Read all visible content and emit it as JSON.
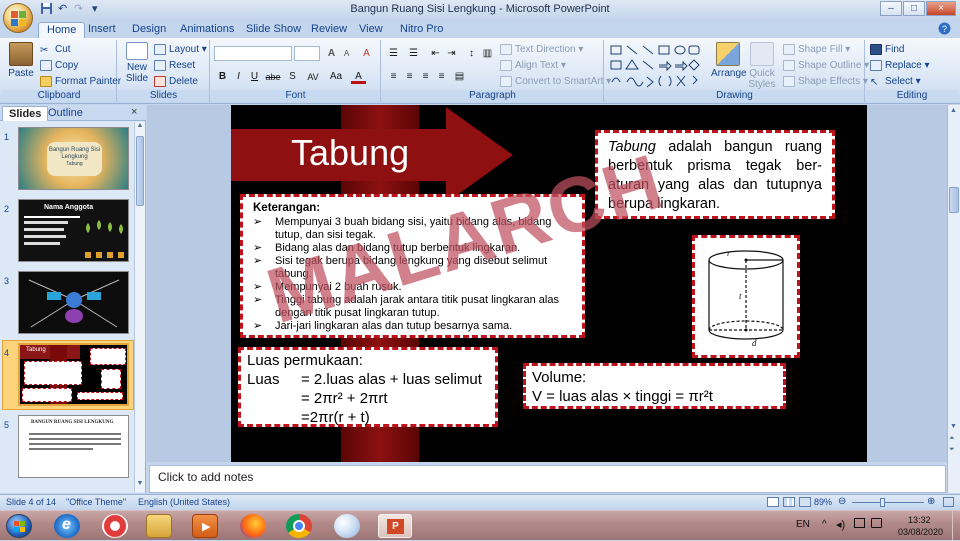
{
  "window": {
    "title": "Bangun Ruang Sisi Lengkung - Microsoft PowerPoint",
    "controls": {
      "minimize": "–",
      "maximize": "□",
      "close": "×"
    }
  },
  "quick_access": [
    "save-icon",
    "undo-icon",
    "redo-icon",
    "customize-icon"
  ],
  "ribbon_tabs": [
    "Home",
    "Insert",
    "Design",
    "Animations",
    "Slide Show",
    "Review",
    "View",
    "Nitro Pro"
  ],
  "active_tab": "Home",
  "ribbon": {
    "clipboard": {
      "paste": "Paste",
      "cut": "Cut",
      "copy": "Copy",
      "format_painter": "Format Painter",
      "label": "Clipboard"
    },
    "slides": {
      "new_slide": "New Slide",
      "layout": "Layout",
      "reset": "Reset",
      "delete": "Delete",
      "label": "Slides"
    },
    "font": {
      "label": "Font",
      "bold": "B",
      "italic": "I",
      "underline": "U",
      "strike": "abe",
      "shadow": "S",
      "spacing": "AV",
      "case": "Aa",
      "color": "A",
      "grow": "A",
      "shrink": "A",
      "clear": "A"
    },
    "paragraph": {
      "label": "Paragraph",
      "text_direction": "Text Direction",
      "align_text": "Align Text",
      "convert_smartart": "Convert to SmartArt"
    },
    "drawing": {
      "label": "Drawing",
      "arrange": "Arrange",
      "quick_styles": "Quick Styles",
      "shape_fill": "Shape Fill",
      "shape_outline": "Shape Outline",
      "shape_effects": "Shape Effects"
    },
    "editing": {
      "label": "Editing",
      "find": "Find",
      "replace": "Replace",
      "select": "Select"
    }
  },
  "left_pane": {
    "tabs": [
      "Slides",
      "Outline"
    ],
    "close": "×",
    "thumbnails": [
      {
        "num": "1",
        "title": "Bangun Ruang Sisi Lengkung",
        "subtitle": "Tabung"
      },
      {
        "num": "2",
        "title": "Nama Anggota"
      },
      {
        "num": "3",
        "title": ""
      },
      {
        "num": "4",
        "title": "Tabung"
      },
      {
        "num": "5",
        "title": "BANGUN RUANG SISI LENGKUNG"
      }
    ],
    "selected": "4"
  },
  "slide": {
    "title": "Tabung",
    "definition_italic": "Tabung",
    "definition_rest": " adalah bangun ruang berbentuk prisma tegak ber-aturan yang alas dan tutupnya berupa lingkaran.",
    "keterangan_heading": "Keterangan:",
    "keterangan_items": [
      "Mempunyai 3 buah bidang sisi, yaitu bidang alas, bidang tutup, dan sisi tegak.",
      "Bidang alas dan bidang tutup berbentuk lingkaran.",
      "Sisi tegak berupa bidang lengkung yang disebut selimut tabung.",
      "Mempunyai 2 buah rusuk.",
      "Tinggi tabung adalah jarak antara titik pusat lingkaran alas dengan titik pusat lingkaran tutup.",
      "Jari-jari lingkaran alas dan tutup besarnya sama."
    ],
    "diagram_labels": {
      "r": "r",
      "t": "t",
      "d": "d"
    },
    "luas": {
      "heading": "Luas permukaan:",
      "label": "Luas",
      "line1": "= 2.luas alas + luas selimut",
      "line2": "= 2πr² + 2πrt",
      "line3": "=2πr(r + t)"
    },
    "volume": {
      "heading": "Volume:",
      "formula": "V = luas alas × tinggi = πr²t"
    },
    "watermark": "MALARCH"
  },
  "notes_placeholder": "Click to add notes",
  "status": {
    "slide_info": "Slide 4 of 14",
    "theme": "\"Office Theme\"",
    "language": "English (United States)",
    "zoom": "89%"
  },
  "taskbar": {
    "language": "EN",
    "time": "13:32",
    "date": "03/08/2020",
    "apps": [
      "start-icon",
      "ie-icon",
      "screen-recorder-icon",
      "file-explorer-icon",
      "media-player-icon",
      "firefox-icon",
      "chrome-icon",
      "paint-icon",
      "powerpoint-icon"
    ]
  },
  "colors": {
    "accent_red": "#c0121b",
    "dark_red": "#7a0a0a",
    "ribbon_text": "#15428b",
    "selection": "#fad37b"
  }
}
